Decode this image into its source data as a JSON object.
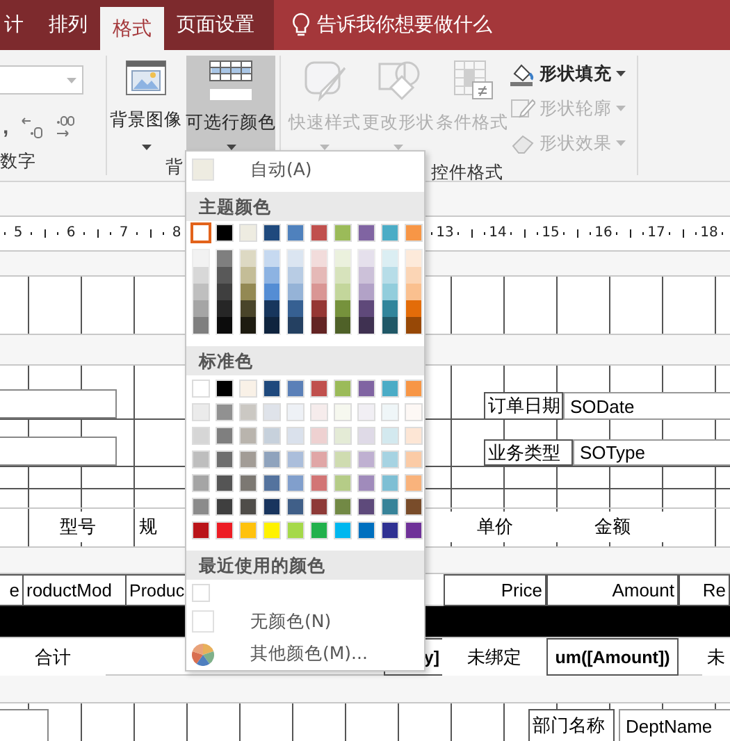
{
  "tabs": [
    {
      "label": "计",
      "selected": false
    },
    {
      "label": "排列",
      "selected": false
    },
    {
      "label": "格式",
      "selected": true
    },
    {
      "label": "页面设置",
      "selected": false
    }
  ],
  "tell_me": {
    "label": "告诉我你想要做什么"
  },
  "number_group": {
    "label": "数字",
    "comma": ","
  },
  "background_group": {
    "label": "背",
    "buttons": [
      {
        "label": "背景图像",
        "pressed": false,
        "kind": "image"
      },
      {
        "label": "可选行颜色",
        "pressed": true,
        "kind": "rows"
      }
    ]
  },
  "control_group": {
    "label": "控件格式",
    "large_buttons": [
      {
        "label": "快速样式",
        "disabled": true,
        "kind": "brush"
      },
      {
        "label": "更改形状",
        "disabled": true,
        "kind": "shapes"
      },
      {
        "label": "条件格式",
        "disabled": true,
        "kind": "conditional"
      }
    ],
    "small_buttons": [
      {
        "label": "形状填充",
        "disabled": false,
        "kind": "fill"
      },
      {
        "label": "形状轮廓",
        "disabled": true,
        "kind": "outline"
      },
      {
        "label": "形状效果",
        "disabled": true,
        "kind": "effect"
      }
    ]
  },
  "ruler": {
    "left_labels": [
      "5",
      "6",
      "7",
      "8"
    ],
    "right_labels": [
      "13",
      "14",
      "15",
      "16",
      "17",
      "18"
    ]
  },
  "color_menu": {
    "auto": {
      "label": "自动(A)",
      "color": "#eeece1"
    },
    "theme_heading": "主题颜色",
    "theme_colors": [
      {
        "color": "#ffffff",
        "selected": true
      },
      {
        "color": "#000000",
        "selected": false
      },
      {
        "color": "#eeece1",
        "selected": false
      },
      {
        "color": "#1f497d",
        "selected": false
      },
      {
        "color": "#4f81bd",
        "selected": false
      },
      {
        "color": "#c0504d",
        "selected": false
      },
      {
        "color": "#9bbb59",
        "selected": false
      },
      {
        "color": "#8064a2",
        "selected": false
      },
      {
        "color": "#4bacc6",
        "selected": false
      },
      {
        "color": "#f79646",
        "selected": false
      }
    ],
    "theme_shades": [
      {
        "shades": [
          {
            "color": "#f2f2f2"
          },
          {
            "color": "#d8d8d8"
          },
          {
            "color": "#bfbfbf"
          },
          {
            "color": "#a5a5a5"
          },
          {
            "color": "#7f7f7f"
          }
        ]
      },
      {
        "shades": [
          {
            "color": "#7f7f7f"
          },
          {
            "color": "#595959"
          },
          {
            "color": "#3f3f3f"
          },
          {
            "color": "#262626"
          },
          {
            "color": "#0c0c0c"
          }
        ]
      },
      {
        "shades": [
          {
            "color": "#ddd9c3"
          },
          {
            "color": "#c4bd97"
          },
          {
            "color": "#938953"
          },
          {
            "color": "#494429"
          },
          {
            "color": "#1d1b10"
          }
        ]
      },
      {
        "shades": [
          {
            "color": "#c6d9f0"
          },
          {
            "color": "#8db3e2"
          },
          {
            "color": "#548dd4"
          },
          {
            "color": "#17365d"
          },
          {
            "color": "#0f243e"
          }
        ]
      },
      {
        "shades": [
          {
            "color": "#dbe5f1"
          },
          {
            "color": "#b8cce4"
          },
          {
            "color": "#95b3d7"
          },
          {
            "color": "#366092"
          },
          {
            "color": "#244061"
          }
        ]
      },
      {
        "shades": [
          {
            "color": "#f2dcdb"
          },
          {
            "color": "#e5b9b7"
          },
          {
            "color": "#d99694"
          },
          {
            "color": "#953734"
          },
          {
            "color": "#632423"
          }
        ]
      },
      {
        "shades": [
          {
            "color": "#ebf1dd"
          },
          {
            "color": "#d7e3bc"
          },
          {
            "color": "#c3d69b"
          },
          {
            "color": "#76923c"
          },
          {
            "color": "#4f6128"
          }
        ]
      },
      {
        "shades": [
          {
            "color": "#e5e0ec"
          },
          {
            "color": "#ccc1d9"
          },
          {
            "color": "#b2a2c7"
          },
          {
            "color": "#5f497a"
          },
          {
            "color": "#3f3151"
          }
        ]
      },
      {
        "shades": [
          {
            "color": "#dbeef3"
          },
          {
            "color": "#b7dde8"
          },
          {
            "color": "#92cddc"
          },
          {
            "color": "#31859b"
          },
          {
            "color": "#205867"
          }
        ]
      },
      {
        "shades": [
          {
            "color": "#fdeada"
          },
          {
            "color": "#fbd5b5"
          },
          {
            "color": "#fac08f"
          },
          {
            "color": "#e36c09"
          },
          {
            "color": "#974806"
          }
        ]
      }
    ],
    "standard_heading": "标准色",
    "standard_rows": [
      {
        "swatches": [
          {
            "color": "#ffffff"
          },
          {
            "color": "#000000"
          },
          {
            "color": "#f9f1e7"
          },
          {
            "color": "#1f497d"
          },
          {
            "color": "#5b80b8"
          },
          {
            "color": "#c0504d"
          },
          {
            "color": "#9bbb59"
          },
          {
            "color": "#8064a2"
          },
          {
            "color": "#4bacc6"
          },
          {
            "color": "#f79646"
          }
        ]
      },
      {
        "swatches": [
          {
            "color": "#ebebeb"
          },
          {
            "color": "#919191"
          },
          {
            "color": "#cbc8c3"
          },
          {
            "color": "#dfe3ea"
          },
          {
            "color": "#eef1f6"
          },
          {
            "color": "#f6ecec"
          },
          {
            "color": "#f6f8ef"
          },
          {
            "color": "#f1eff4"
          },
          {
            "color": "#eff6f8"
          },
          {
            "color": "#fdf8f5"
          }
        ]
      },
      {
        "swatches": [
          {
            "color": "#d6d6d6"
          },
          {
            "color": "#7f7f7f"
          },
          {
            "color": "#b9b4ad"
          },
          {
            "color": "#c7d1dc"
          },
          {
            "color": "#dae1ec"
          },
          {
            "color": "#eed1d1"
          },
          {
            "color": "#e4ebd6"
          },
          {
            "color": "#dfdae7"
          },
          {
            "color": "#d3e9ef"
          },
          {
            "color": "#fde6d5"
          }
        ]
      },
      {
        "swatches": [
          {
            "color": "#bebebe"
          },
          {
            "color": "#6e6e6e"
          },
          {
            "color": "#a29c96"
          },
          {
            "color": "#8fa3bd"
          },
          {
            "color": "#abbedb"
          },
          {
            "color": "#e0a6a6"
          },
          {
            "color": "#cfdcb0"
          },
          {
            "color": "#bfb0d1"
          },
          {
            "color": "#a6d3e2"
          },
          {
            "color": "#fbcba6"
          }
        ]
      },
      {
        "swatches": [
          {
            "color": "#a5a5a5"
          },
          {
            "color": "#555555"
          },
          {
            "color": "#7c7872"
          },
          {
            "color": "#54739e"
          },
          {
            "color": "#819fcc"
          },
          {
            "color": "#d27575"
          },
          {
            "color": "#b5cc87"
          },
          {
            "color": "#a08bbb"
          },
          {
            "color": "#7ebfd4"
          },
          {
            "color": "#f9b37c"
          }
        ]
      },
      {
        "swatches": [
          {
            "color": "#8b8b8b"
          },
          {
            "color": "#3f3f3f"
          },
          {
            "color": "#4f4d49"
          },
          {
            "color": "#19355e"
          },
          {
            "color": "#405f88"
          },
          {
            "color": "#8e3a37"
          },
          {
            "color": "#728945"
          },
          {
            "color": "#5e4a7b"
          },
          {
            "color": "#388399"
          },
          {
            "color": "#794c2a"
          }
        ]
      },
      {
        "swatches": [
          {
            "color": "#ba1419"
          },
          {
            "color": "#ed1c24"
          },
          {
            "color": "#ffc20e"
          },
          {
            "color": "#fff200"
          },
          {
            "color": "#a5d94a"
          },
          {
            "color": "#22b14c"
          },
          {
            "color": "#00b7ef"
          },
          {
            "color": "#0070bf"
          },
          {
            "color": "#2f3192"
          },
          {
            "color": "#6f3198"
          }
        ]
      }
    ],
    "recent_heading": "最近使用的颜色",
    "recent_colors": [
      {
        "color": "#ffffff"
      }
    ],
    "no_color": {
      "label": "无颜色(N)"
    },
    "more_colors": {
      "label": "其他颜色(M)..."
    }
  },
  "report": {
    "header_fields": [
      {
        "text": "订单日期",
        "kind": "label"
      },
      {
        "text": "SODate",
        "kind": "textbox"
      },
      {
        "text": "业务类型",
        "kind": "label"
      },
      {
        "text": "SOType",
        "kind": "textbox"
      }
    ],
    "column_headings": [
      "型号",
      "规",
      "单价",
      "金额"
    ],
    "detail_fields": [
      "e",
      "roductMod",
      "Produc",
      "Price",
      "Amount",
      "Re"
    ],
    "total_fields": [
      {
        "text": "合计",
        "kind": "label"
      },
      {
        "text": "y]",
        "kind": "expression"
      },
      {
        "text": "未绑定",
        "kind": "label"
      },
      {
        "text": "um([Amount])",
        "kind": "expression"
      },
      {
        "text": "未",
        "kind": "label"
      }
    ],
    "footer_fields": [
      {
        "text": "部门名称",
        "kind": "label"
      },
      {
        "text": "DeptName",
        "kind": "textbox"
      }
    ]
  }
}
